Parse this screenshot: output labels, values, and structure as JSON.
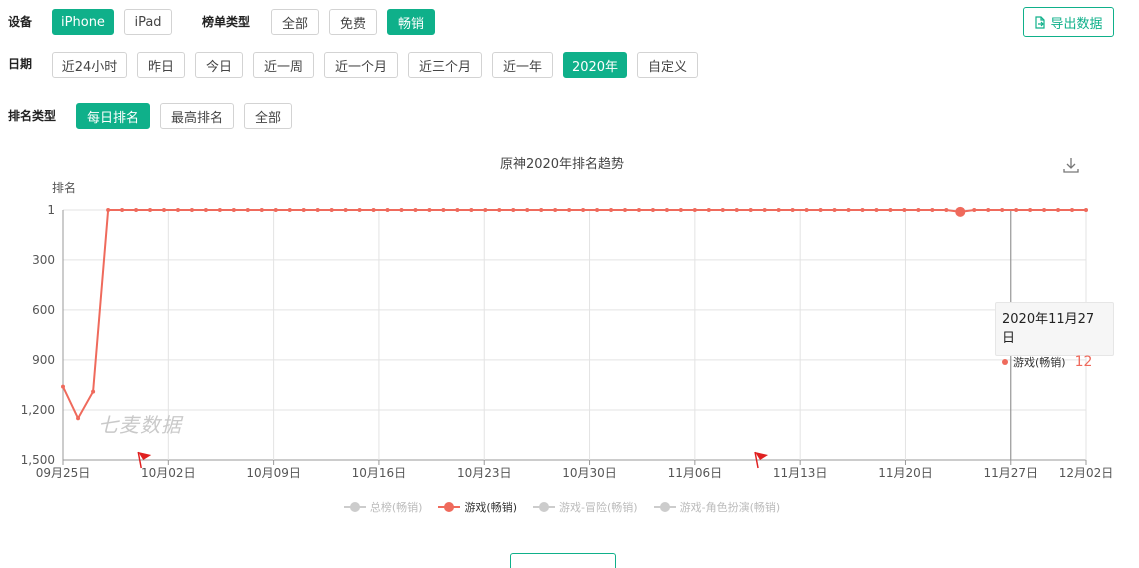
{
  "filters": {
    "device": {
      "label": "设备",
      "options": [
        "iPhone",
        "iPad"
      ],
      "active": 0
    },
    "list_type": {
      "label": "榜单类型",
      "options": [
        "全部",
        "免费",
        "畅销"
      ],
      "active": 2
    },
    "date": {
      "label": "日期",
      "options": [
        "近24小时",
        "昨日",
        "今日",
        "近一周",
        "近一个月",
        "近三个月",
        "近一年",
        "2020年",
        "自定义"
      ],
      "active": 7
    },
    "rank_type": {
      "label": "排名类型",
      "options": [
        "每日排名",
        "最高排名",
        "全部"
      ],
      "active": 0
    }
  },
  "export_label": "导出数据",
  "watermark": "七麦数据",
  "tooltip": {
    "date": "2020年11月27日",
    "series": "游戏(畅销)",
    "value": "12"
  },
  "colors": {
    "accent": "#0fb08a",
    "series": "#ef6a5c"
  },
  "icons": {
    "export": "export-icon",
    "download": "download-icon",
    "flag": "flag-icon"
  },
  "chart_data": {
    "type": "line",
    "title": "原神2020年排名趋势",
    "ylabel": "排名",
    "y_inverted": true,
    "ylim": [
      1,
      1500
    ],
    "yticks": [
      "1",
      "300",
      "600",
      "900",
      "1,200",
      "1,500"
    ],
    "xticks": [
      "09月25日",
      "10月02日",
      "10月09日",
      "10月16日",
      "10月23日",
      "10月30日",
      "11月06日",
      "11月13日",
      "11月20日",
      "11月27日",
      "12月02日"
    ],
    "legend": [
      {
        "name": "总榜(畅销)",
        "active": false
      },
      {
        "name": "游戏(畅销)",
        "active": true
      },
      {
        "name": "游戏-冒险(畅销)",
        "active": false
      },
      {
        "name": "游戏-角色扮演(畅销)",
        "active": false
      }
    ],
    "series": [
      {
        "name": "游戏(畅销)",
        "x_start": "2020-09-25",
        "values": [
          1060,
          1250,
          1090,
          1,
          1,
          1,
          1,
          1,
          1,
          1,
          1,
          1,
          1,
          1,
          1,
          1,
          1,
          1,
          1,
          1,
          1,
          1,
          1,
          1,
          1,
          1,
          1,
          1,
          1,
          1,
          1,
          1,
          1,
          1,
          1,
          1,
          1,
          1,
          1,
          1,
          1,
          1,
          1,
          1,
          1,
          1,
          1,
          1,
          1,
          1,
          1,
          1,
          1,
          1,
          1,
          1,
          1,
          1,
          1,
          1,
          1,
          1,
          1,
          1,
          12,
          1,
          1,
          1,
          1,
          1,
          1,
          1,
          1,
          1
        ]
      }
    ],
    "highlight": {
      "date": "2020年11月27日",
      "value": 12
    },
    "flags": [
      "09月30日",
      "11月10日"
    ]
  }
}
